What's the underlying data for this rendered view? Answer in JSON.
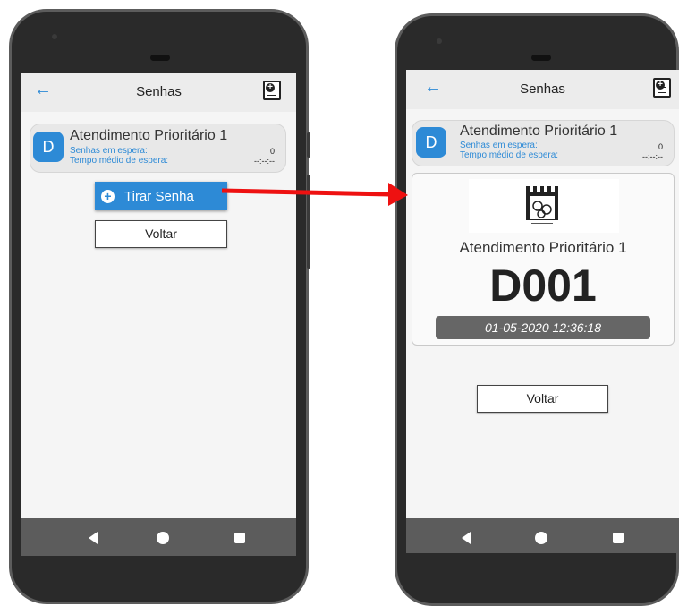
{
  "left_screen": {
    "header": {
      "title": "Senhas",
      "back_icon": "arrow-left-icon",
      "action_icon": "add-ticket-icon"
    },
    "service": {
      "avatar_letter": "D",
      "name": "Atendimento Prioritário 1",
      "waiting_label": "Senhas em espera:",
      "waiting_value": "0",
      "avg_label": "Tempo médio de espera:",
      "avg_value": "--:--:--"
    },
    "actions": {
      "take_ticket_label": "Tirar Senha",
      "back_label": "Voltar"
    }
  },
  "right_screen": {
    "header": {
      "title": "Senhas",
      "back_icon": "arrow-left-icon",
      "action_icon": "add-ticket-icon"
    },
    "service": {
      "avatar_letter": "D",
      "name": "Atendimento Prioritário 1",
      "waiting_label": "Senhas em espera:",
      "waiting_value": "0",
      "avg_label": "Tempo médio de espera:",
      "avg_value": "--:--:--"
    },
    "ticket": {
      "logo_icon": "institution-logo",
      "service_name": "Atendimento Prioritário 1",
      "code": "D001",
      "datetime": "01-05-2020 12:36:18"
    },
    "actions": {
      "back_label": "Voltar"
    }
  },
  "colors": {
    "accent": "#2d8ad6",
    "arrow": "#ee1111",
    "navbar": "#5c5c5c",
    "phone_body": "#2a2a2a"
  }
}
